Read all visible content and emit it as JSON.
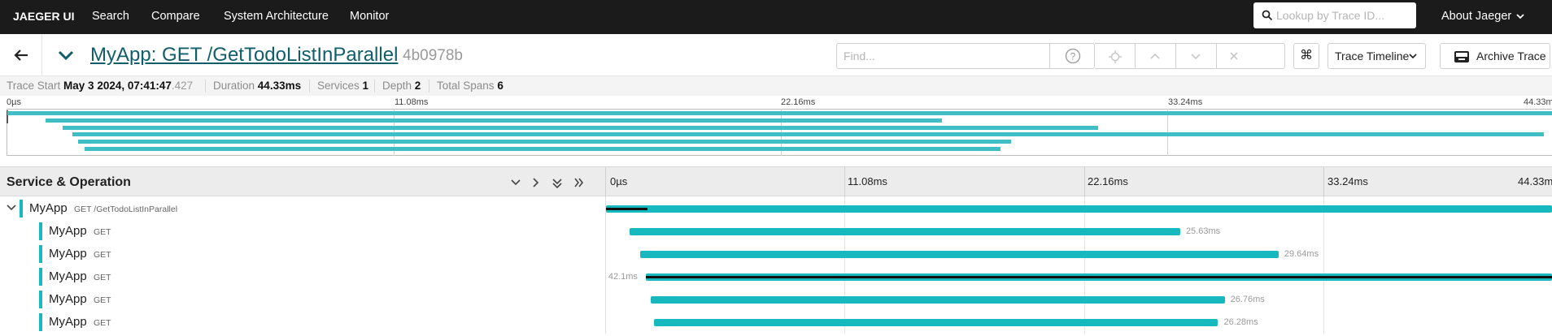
{
  "nav": {
    "brand": "JAEGER UI",
    "links": [
      "Search",
      "Compare",
      "System Architecture",
      "Monitor"
    ],
    "lookup_placeholder": "Lookup by Trace ID...",
    "about": "About Jaeger"
  },
  "trace": {
    "title": "MyApp: GET /GetTodoListInParallel",
    "id": "4b0978b",
    "find_placeholder": "Find...",
    "view_select": "Trace Timeline",
    "archive_label": "Archive Trace",
    "cmd_symbol": "⌘"
  },
  "summary": {
    "start_label": "Trace Start",
    "start_value": "May 3 2024, 07:41:47",
    "start_ms": ".427",
    "duration_label": "Duration",
    "duration_value": "44.33ms",
    "services_label": "Services",
    "services_value": "1",
    "depth_label": "Depth",
    "depth_value": "2",
    "spans_label": "Total Spans",
    "spans_value": "6"
  },
  "minimap": {
    "ticks": [
      "0µs",
      "11.08ms",
      "22.16ms",
      "33.24ms",
      "44.33ms"
    ],
    "bars": [
      {
        "start": 0.0,
        "end": 1.0
      },
      {
        "start": 0.025,
        "end": 0.605
      },
      {
        "start": 0.036,
        "end": 0.706
      },
      {
        "start": 0.042,
        "end": 0.995
      },
      {
        "start": 0.046,
        "end": 0.65
      },
      {
        "start": 0.05,
        "end": 0.643
      }
    ]
  },
  "table": {
    "header": "Service & Operation",
    "ticks": [
      "0µs",
      "11.08ms",
      "22.16ms",
      "33.24ms",
      "44.33ms"
    ],
    "rows": [
      {
        "service": "MyApp",
        "operation": "GET /GetTodoListInParallel",
        "duration": "",
        "start": 0.0,
        "end": 1.0,
        "self_end": 0.044,
        "has_children": true
      },
      {
        "service": "MyApp",
        "operation": "GET",
        "duration": "25.63ms",
        "start": 0.025,
        "end": 0.607,
        "has_children": false
      },
      {
        "service": "MyApp",
        "operation": "GET",
        "duration": "29.64ms",
        "start": 0.036,
        "end": 0.711,
        "has_children": false
      },
      {
        "service": "MyApp",
        "operation": "GET",
        "duration": "42.1ms",
        "start": 0.042,
        "end": 1.0,
        "self_full": true,
        "label_left": true,
        "has_children": false
      },
      {
        "service": "MyApp",
        "operation": "GET",
        "duration": "26.76ms",
        "start": 0.047,
        "end": 0.654,
        "has_children": false
      },
      {
        "service": "MyApp",
        "operation": "GET",
        "duration": "26.28ms",
        "start": 0.051,
        "end": 0.647,
        "has_children": false
      }
    ]
  },
  "colors": {
    "span": "#17b8be",
    "nav_bg": "#1b1b1b"
  }
}
